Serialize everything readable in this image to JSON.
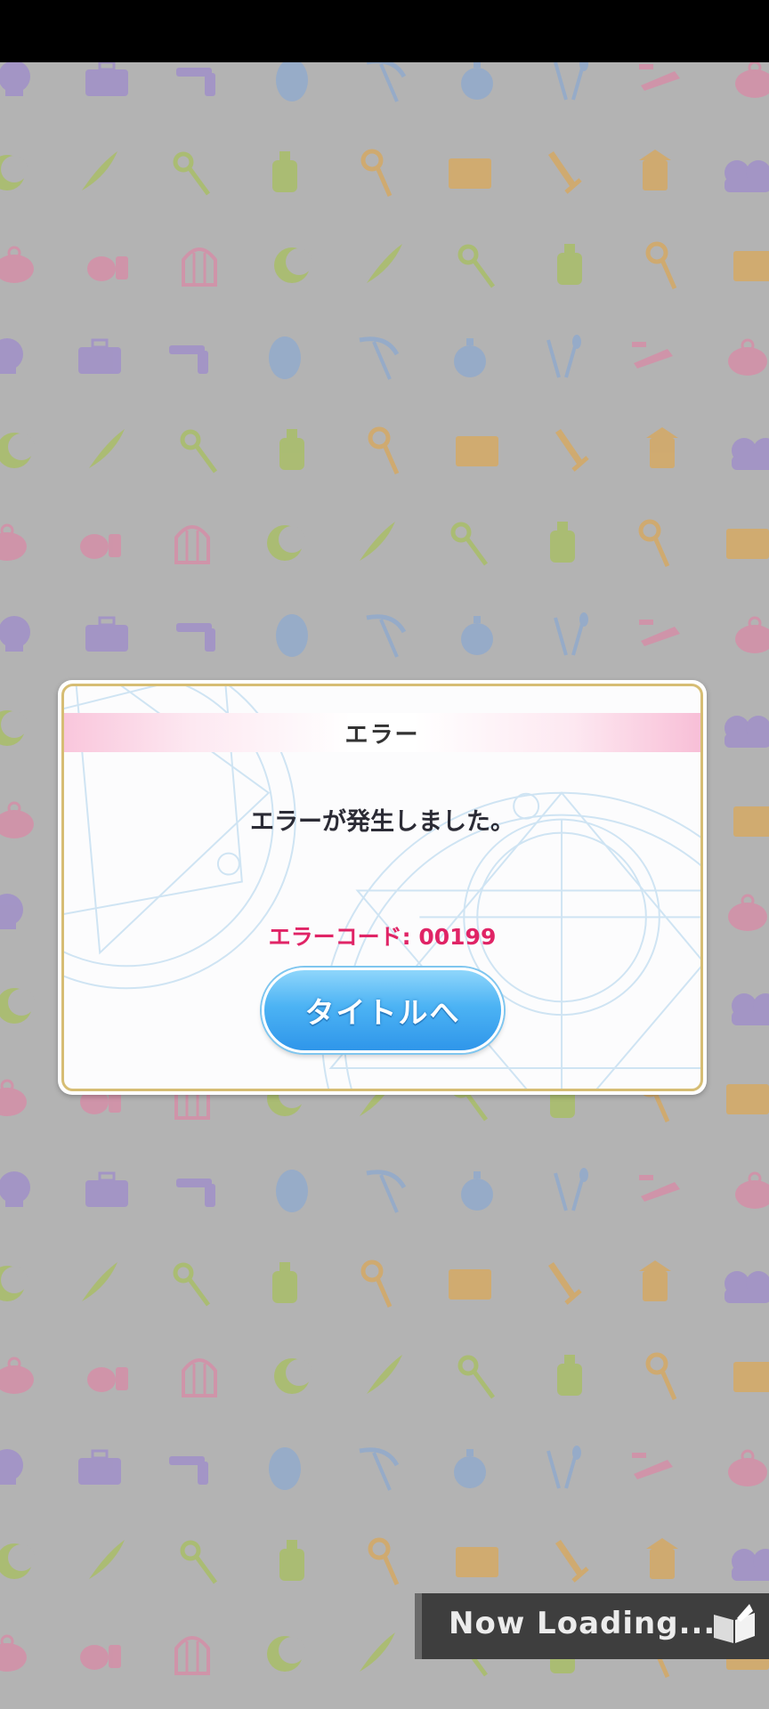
{
  "dialog": {
    "title": "エラー",
    "message": "エラーが発生しました。",
    "error_code": "エラーコード: 00199",
    "button_label": "タイトルへ"
  },
  "loading": {
    "text": "Now Loading...",
    "icon": "book-icon"
  },
  "background_pattern": {
    "icons": [
      "skull-icon",
      "briefcase-icon",
      "revolver-icon",
      "mirror-icon",
      "scythe-icon",
      "stopwatch-icon",
      "cutlery-icon",
      "pipe-icon",
      "purse-icon",
      "crescent-icon",
      "feather-icon",
      "key-icon",
      "potion-icon",
      "staff-icon",
      "book-icon",
      "sword-icon",
      "lantern-icon",
      "cats-icon",
      "pincushion-icon",
      "birdcage-icon"
    ],
    "colors": {
      "purple": "#9e8bcc",
      "green": "#a8bf5e",
      "orange": "#d9a85a",
      "pink": "#d98aa6",
      "blue": "#8da9cf"
    }
  },
  "colors": {
    "dialog_border": "#d6bd74",
    "error_code": "#e02466",
    "button": "#4cb3f4",
    "loading_bg": "#3e3e3e"
  }
}
